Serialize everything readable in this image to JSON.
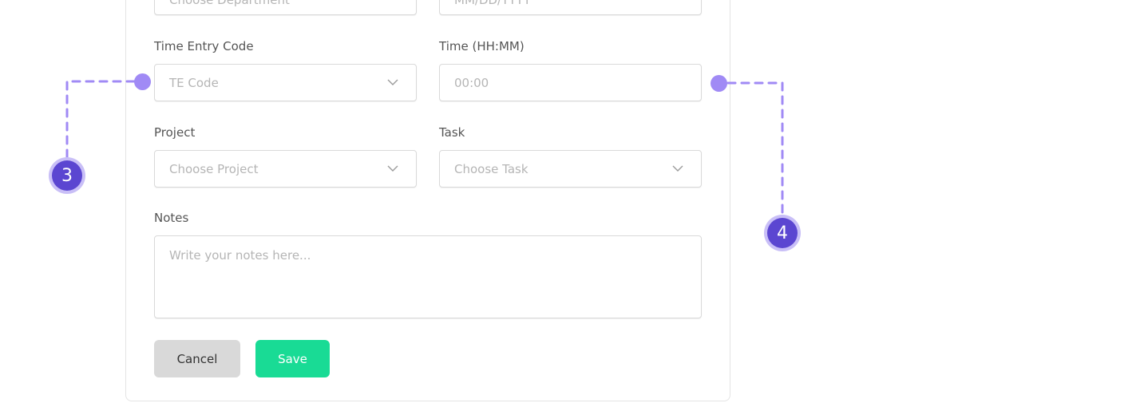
{
  "form": {
    "department": {
      "placeholder": "Choose Department"
    },
    "date": {
      "placeholder": "MM/DD/YYYY"
    },
    "time_entry_code": {
      "label": "Time Entry Code",
      "placeholder": "TE Code"
    },
    "time": {
      "label": "Time (HH:MM)",
      "placeholder": "00:00"
    },
    "project": {
      "label": "Project",
      "placeholder": "Choose Project"
    },
    "task": {
      "label": "Task",
      "placeholder": "Choose Task"
    },
    "notes": {
      "label": "Notes",
      "placeholder": "Write your notes here..."
    },
    "buttons": {
      "cancel": "Cancel",
      "save": "Save"
    }
  },
  "annotations": [
    {
      "number": "3",
      "target": "time_entry_code"
    },
    {
      "number": "4",
      "target": "time"
    }
  ],
  "colors": {
    "accent": "#5b46d1",
    "annotation_line": "#a08af5",
    "save": "#19db95",
    "cancel": "#d9d9d9"
  }
}
